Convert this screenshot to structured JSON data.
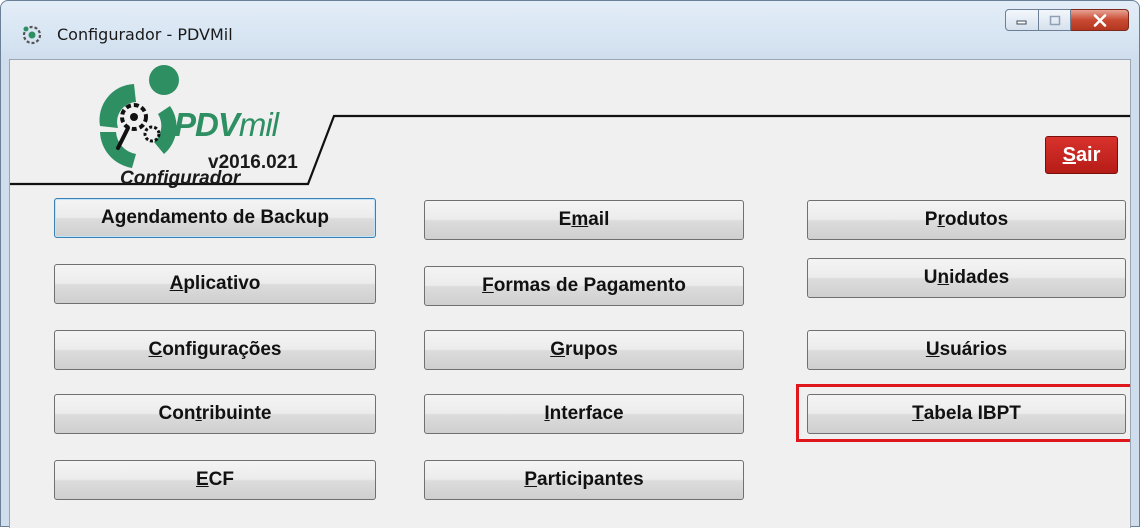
{
  "window": {
    "title": "Configurador - PDVMil",
    "controls": {
      "minimize": "minimize",
      "maximize": "maximize",
      "close": "close"
    }
  },
  "logo": {
    "brand_main": "PDV",
    "brand_suffix": "mil",
    "version": "v2016.021",
    "subtitle": "Configurador",
    "color": "#2d8f62"
  },
  "exit_button": {
    "pre": "",
    "key": "S",
    "post": "air",
    "color": "#c0231e"
  },
  "buttons": {
    "col1": [
      {
        "pre": "A",
        "key": "g",
        "post": "endamento de Backup"
      },
      {
        "pre": "",
        "key": "A",
        "post": "plicativo"
      },
      {
        "pre": "",
        "key": "C",
        "post": "onfigurações"
      },
      {
        "pre": "Con",
        "key": "t",
        "post": "ribuinte"
      },
      {
        "pre": "",
        "key": "E",
        "post": "CF"
      }
    ],
    "col2": [
      {
        "pre": "E",
        "key": "m",
        "post": "ail"
      },
      {
        "pre": "",
        "key": "F",
        "post": "ormas de Pagamento"
      },
      {
        "pre": "",
        "key": "G",
        "post": "rupos"
      },
      {
        "pre": "",
        "key": "I",
        "post": "nterface"
      },
      {
        "pre": "",
        "key": "P",
        "post": "articipantes"
      }
    ],
    "col3": [
      {
        "pre": "P",
        "key": "r",
        "post": "odutos"
      },
      {
        "pre": "U",
        "key": "n",
        "post": "idades"
      },
      {
        "pre": "",
        "key": "U",
        "post": "suários"
      },
      {
        "pre": "",
        "key": "T",
        "post": "abela IBPT"
      }
    ]
  },
  "highlight_color": "#e0161d"
}
